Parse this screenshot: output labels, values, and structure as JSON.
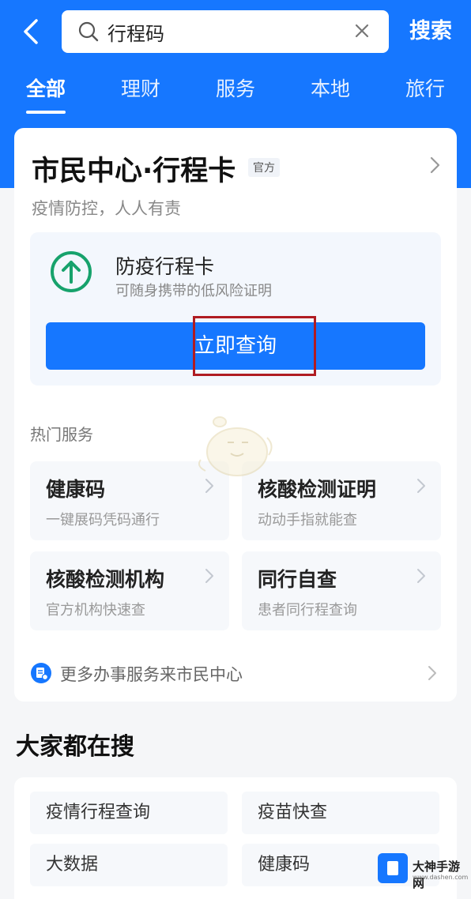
{
  "header": {
    "search_value": "行程码",
    "search_button": "搜索"
  },
  "tabs": [
    {
      "label": "全部",
      "active": true
    },
    {
      "label": "理财",
      "active": false
    },
    {
      "label": "服务",
      "active": false
    },
    {
      "label": "本地",
      "active": false
    },
    {
      "label": "旅行",
      "active": false
    }
  ],
  "card": {
    "title": "市民中心·行程卡",
    "badge": "官方",
    "subtitle": "疫情防控，人人有责",
    "feature": {
      "title": "防疫行程卡",
      "desc": "可随身携带的低风险证明",
      "button": "立即查询"
    },
    "hot_label": "热门服务",
    "services": [
      {
        "title": "健康码",
        "desc": "一键展码凭码通行"
      },
      {
        "title": "核酸检测证明",
        "desc": "动动手指就能查"
      },
      {
        "title": "核酸检测机构",
        "desc": "官方机构快速查"
      },
      {
        "title": "同行自查",
        "desc": "患者同行程查询"
      }
    ],
    "more_text": "更多办事服务来市民中心"
  },
  "trending": {
    "title": "大家都在搜",
    "items": [
      "疫情行程查询",
      "疫苗快查",
      "大数据",
      "健康码"
    ]
  },
  "brand": {
    "name": "大神手游网",
    "sub": "www.dashen.com"
  },
  "colors": {
    "primary": "#1677ff",
    "accent_green": "#17a26c",
    "highlight_red": "#b01c22"
  }
}
